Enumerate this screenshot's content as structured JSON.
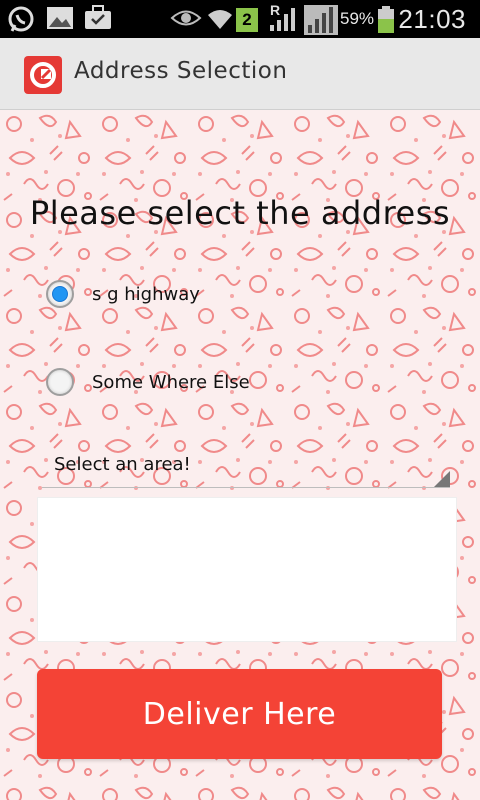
{
  "status_bar": {
    "battery_percent": "59%",
    "time": "21:03",
    "notification_badge": "2",
    "roaming": "R",
    "icons": [
      "whatsapp-icon",
      "gallery-icon",
      "briefcase-icon",
      "eye-icon",
      "wifi-icon",
      "signal-icon",
      "signal-icon-2",
      "battery-icon"
    ]
  },
  "action_bar": {
    "title": "Address Selection",
    "app_icon": "app-logo-icon"
  },
  "main": {
    "heading": "Please select the address",
    "options": [
      {
        "label": "s g highway",
        "checked": true
      },
      {
        "label": "Some Where Else",
        "checked": false
      }
    ],
    "area_spinner": {
      "label": "Select an area!"
    },
    "address_field": {
      "value": ""
    },
    "deliver_button": {
      "label": "Deliver Here"
    }
  },
  "colors": {
    "accent": "#f44336",
    "radio_checked": "#2196f3",
    "background_pattern": "#f08a8a"
  }
}
